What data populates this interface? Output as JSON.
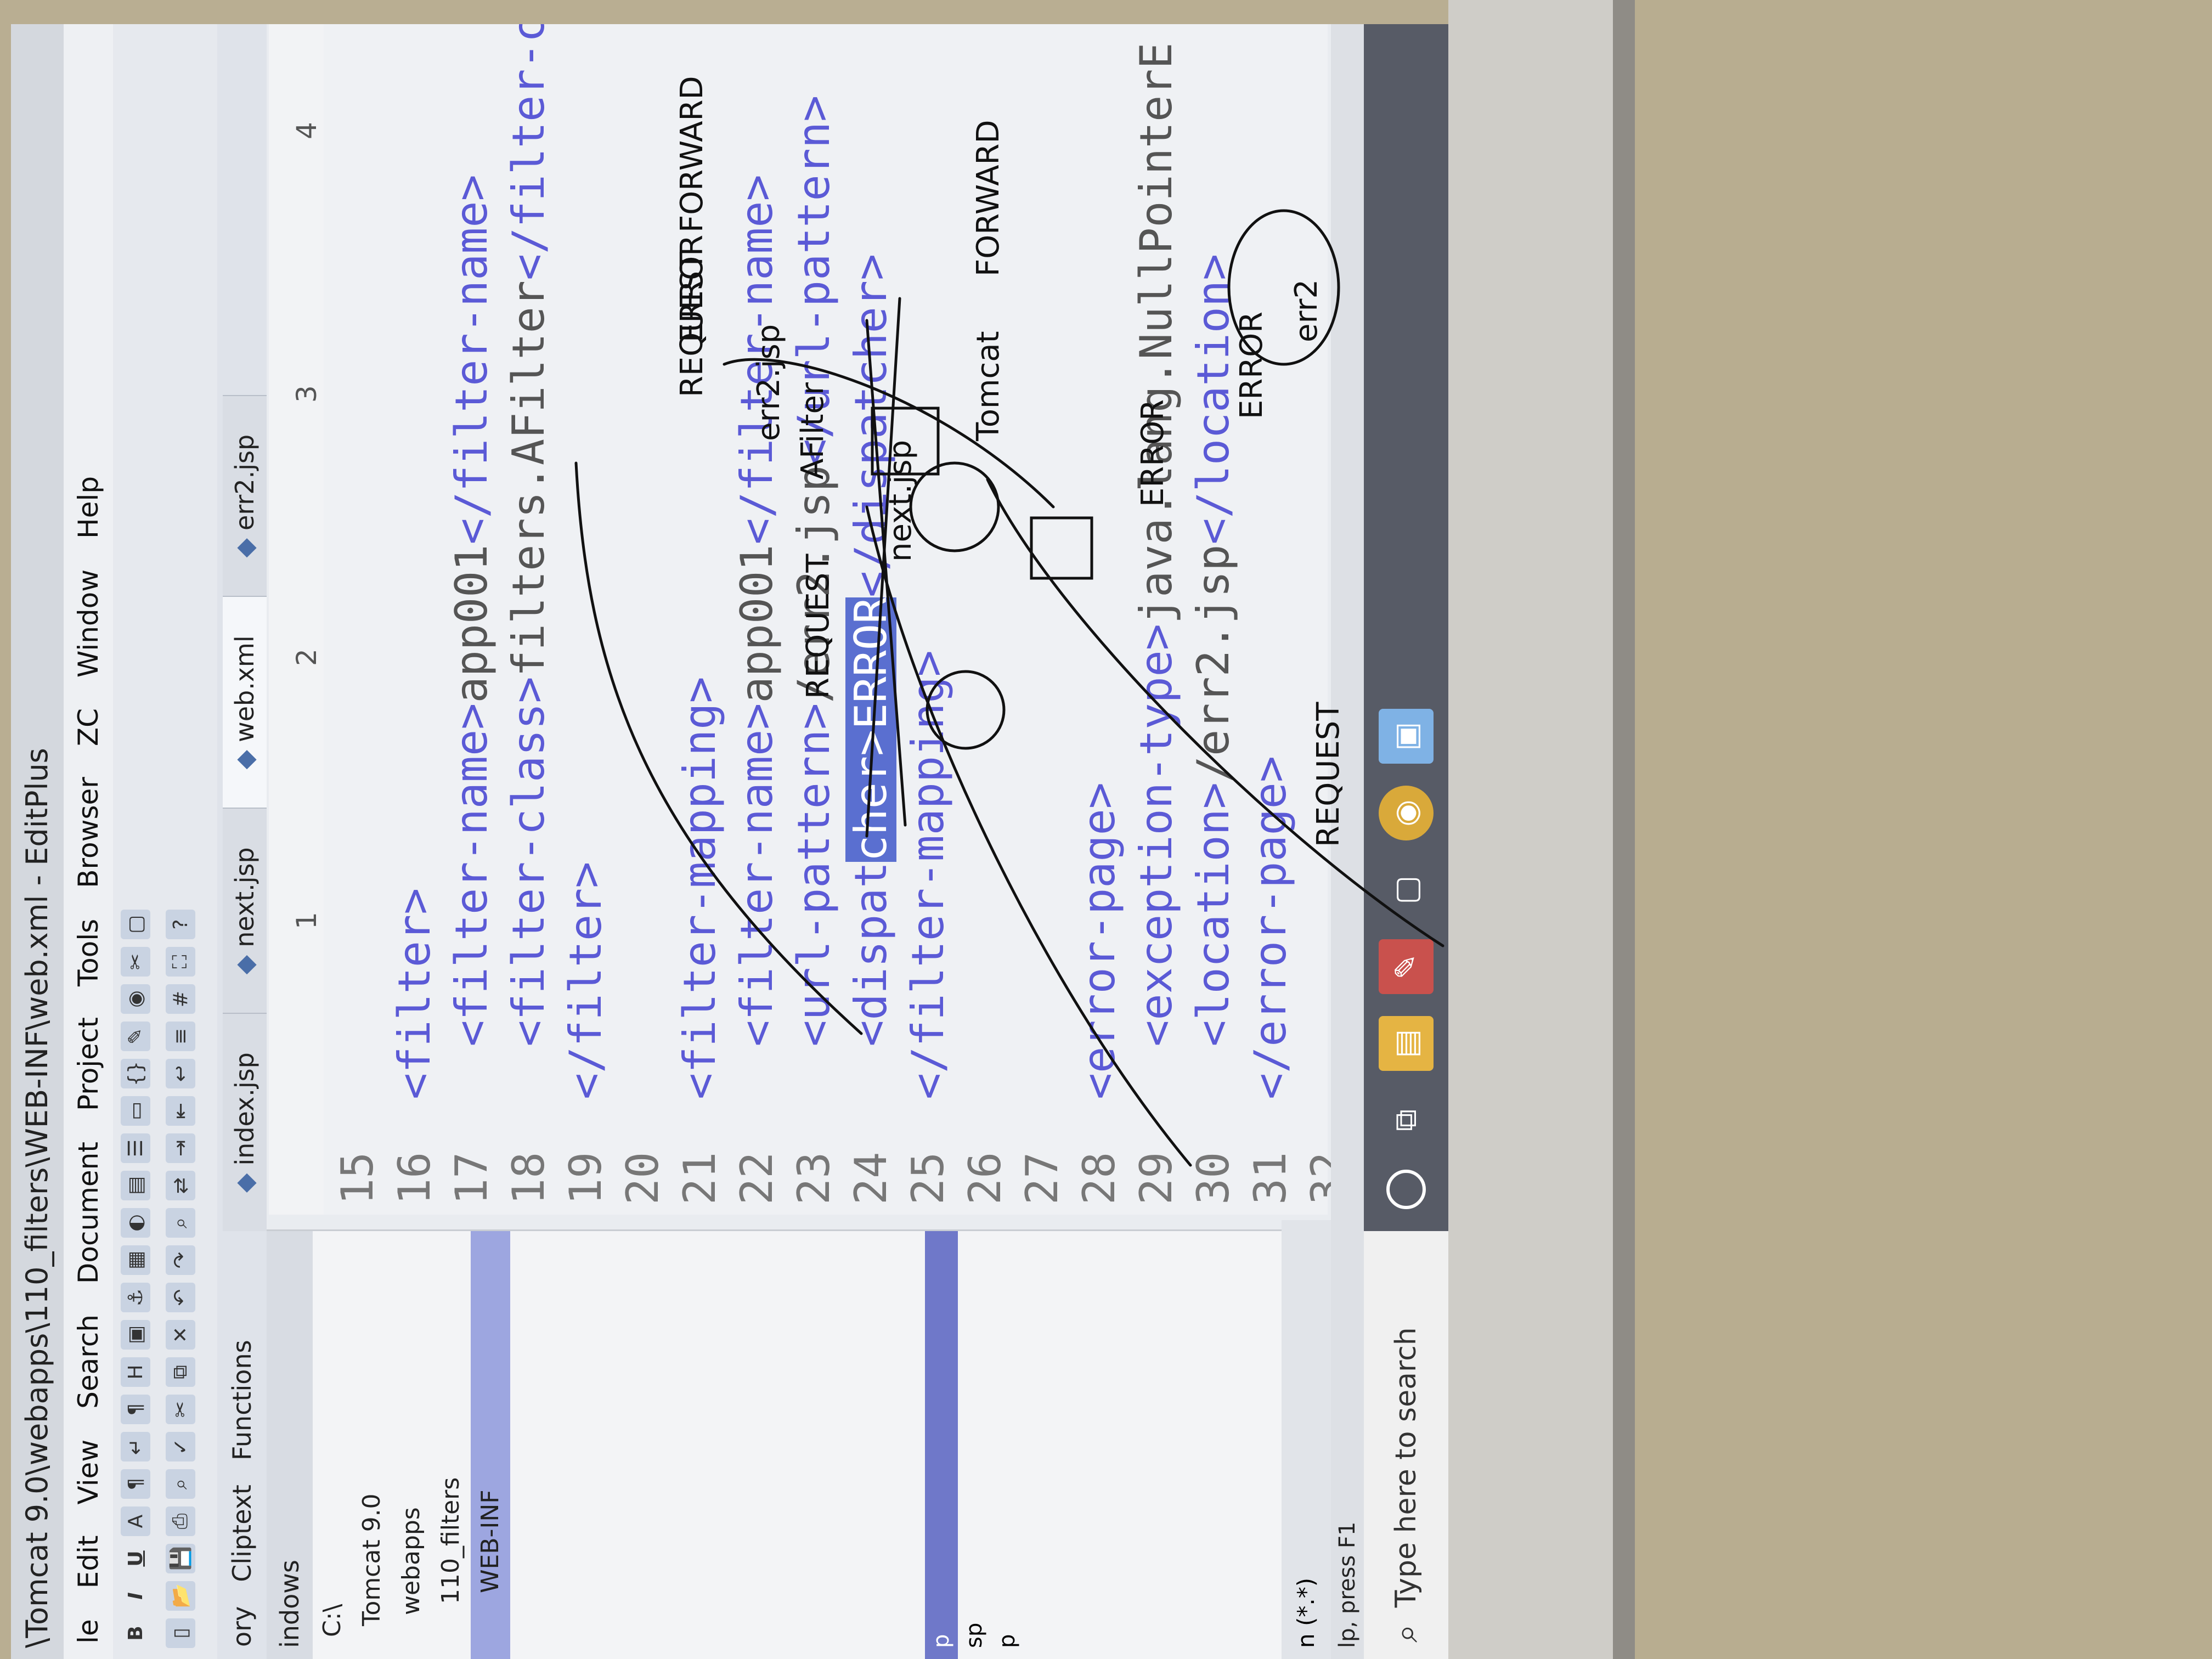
{
  "window": {
    "title": "\\Tomcat 9.0\\webapps\\110_filters\\WEB-INF\\web.xml - EditPlus"
  },
  "menu": [
    "le",
    "Edit",
    "View",
    "Search",
    "Document",
    "Project",
    "Tools",
    "Browser",
    "ZC",
    "Window",
    "Help"
  ],
  "side_tabs": [
    "ory",
    "Cliptext",
    "Functions"
  ],
  "doc_tabs": [
    "index.jsp",
    "next.jsp",
    "web.xml",
    "err2.jsp"
  ],
  "active_tab_index": 2,
  "sidebar": {
    "drive_header": "indows",
    "tree": [
      "C:\\",
      "Tomcat 9.0",
      "webapps",
      "110_filters",
      "WEB-INF"
    ],
    "files": [
      "p",
      "sp",
      "p"
    ],
    "filter": "n (*.*)"
  },
  "ruler": [
    "1",
    "2",
    "3",
    "4"
  ],
  "editor_lines": [
    {
      "n": "15",
      "indent": "",
      "parts": []
    },
    {
      "n": "16",
      "indent": "",
      "parts": [
        [
          "tag",
          "<filter>"
        ]
      ]
    },
    {
      "n": "17",
      "indent": "  ",
      "parts": [
        [
          "tag",
          "<filter-name>"
        ],
        [
          "txt",
          "app001"
        ],
        [
          "tag",
          "</filter-name>"
        ]
      ]
    },
    {
      "n": "18",
      "indent": "  ",
      "parts": [
        [
          "tag",
          "<filter-class>"
        ],
        [
          "txt",
          "filters.AFilter"
        ],
        [
          "tag",
          "</filter-class>"
        ]
      ]
    },
    {
      "n": "19",
      "indent": "",
      "parts": [
        [
          "tag",
          "</filter>"
        ]
      ]
    },
    {
      "n": "20",
      "indent": "",
      "parts": []
    },
    {
      "n": "21",
      "indent": "",
      "parts": [
        [
          "tag",
          "<filter-mapping>"
        ]
      ]
    },
    {
      "n": "22",
      "indent": "  ",
      "parts": [
        [
          "tag",
          "<filter-name>"
        ],
        [
          "txt",
          "app001"
        ],
        [
          "tag",
          "</filter-name>"
        ]
      ]
    },
    {
      "n": "23",
      "indent": "  ",
      "parts": [
        [
          "tag",
          "<url-pattern>"
        ],
        [
          "txt",
          "/err2.jsp"
        ],
        [
          "tag",
          "</url-pattern>"
        ]
      ]
    },
    {
      "n": "24",
      "indent": "  ",
      "parts": [
        [
          "tag",
          "<dispat"
        ],
        [
          "hl",
          "cher>ERROR"
        ],
        [
          "tag",
          "</dispatcher>"
        ]
      ]
    },
    {
      "n": "25",
      "indent": "",
      "parts": [
        [
          "tag",
          "</filter-mapping>"
        ]
      ]
    },
    {
      "n": "26",
      "indent": "",
      "parts": []
    },
    {
      "n": "27",
      "indent": "",
      "parts": []
    },
    {
      "n": "28",
      "indent": "",
      "parts": [
        [
          "tag",
          "<error-page>"
        ]
      ]
    },
    {
      "n": "29",
      "indent": "  ",
      "parts": [
        [
          "tag",
          "<exception-type>"
        ],
        [
          "txt",
          "java.lang.NullPointerE"
        ]
      ]
    },
    {
      "n": "30",
      "indent": "  ",
      "parts": [
        [
          "tag",
          "<location>"
        ],
        [
          "txt",
          "/err2.jsp"
        ],
        [
          "tag",
          "</location>"
        ]
      ]
    },
    {
      "n": "31",
      "indent": "",
      "parts": [
        [
          "tag",
          "</error-page>"
        ]
      ]
    },
    {
      "n": "32",
      "indent": "",
      "parts": []
    }
  ],
  "status": "lp, press F1",
  "taskbar": {
    "search_placeholder": "Type here to search"
  },
  "annotations": [
    "REQUEST",
    "AFilter",
    "next.jsp",
    "err2.jsp",
    "REQUEST",
    "ERROR",
    "FORWARD",
    "Tomcat",
    "FORWARD",
    "REQUEST",
    "ERROR",
    "ERROR",
    "err2",
    "NullPointerE"
  ],
  "colors": {
    "tag": "#5b5ad6",
    "text": "#555555",
    "highlight": "#5a6fd0",
    "taskbar": "#575b66"
  }
}
